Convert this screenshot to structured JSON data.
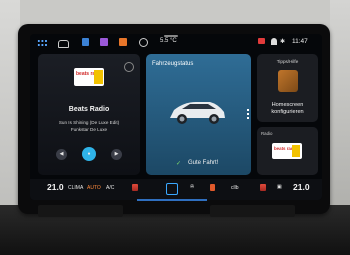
{
  "status_bar": {
    "temperature": "5.5 °C",
    "clock": "11:47",
    "bluetooth_symbol": "✱"
  },
  "radio_tile": {
    "logo_text": "beats radio",
    "station_name": "Beats Radio",
    "song_title": "Sun Is Shining (De Luxe Edit)",
    "song_artist": "Funkstar De Luxe",
    "prev_symbol": "◀",
    "play_symbol": "●",
    "next_symbol": "▶"
  },
  "vehicle_status_tile": {
    "title": "Fahrzeugstatus",
    "status_check": "✓",
    "status_text": "Gute Fahrt!"
  },
  "tips_tile": {
    "title": "Tipps/Hilfe",
    "label_line1": "Homescreen",
    "label_line2": "konfigurieren"
  },
  "radio_mini_tile": {
    "title": "Radio",
    "logo_text": "beats radio"
  },
  "climate_bar": {
    "temp_left": "21.0",
    "climate_label": "CLIMA",
    "auto_label": "AUTO",
    "ac_label": "A/C",
    "defrost_label": "cllb",
    "temp_right": "21.0",
    "fan_symbol": "✇",
    "seat_symbol": "▣"
  },
  "colors": {
    "accent_blue": "#2fb3e8",
    "auto_orange": "#ff8a3d",
    "vehicle_tile": "#2f6d96",
    "status_green": "#7cdc6a"
  }
}
